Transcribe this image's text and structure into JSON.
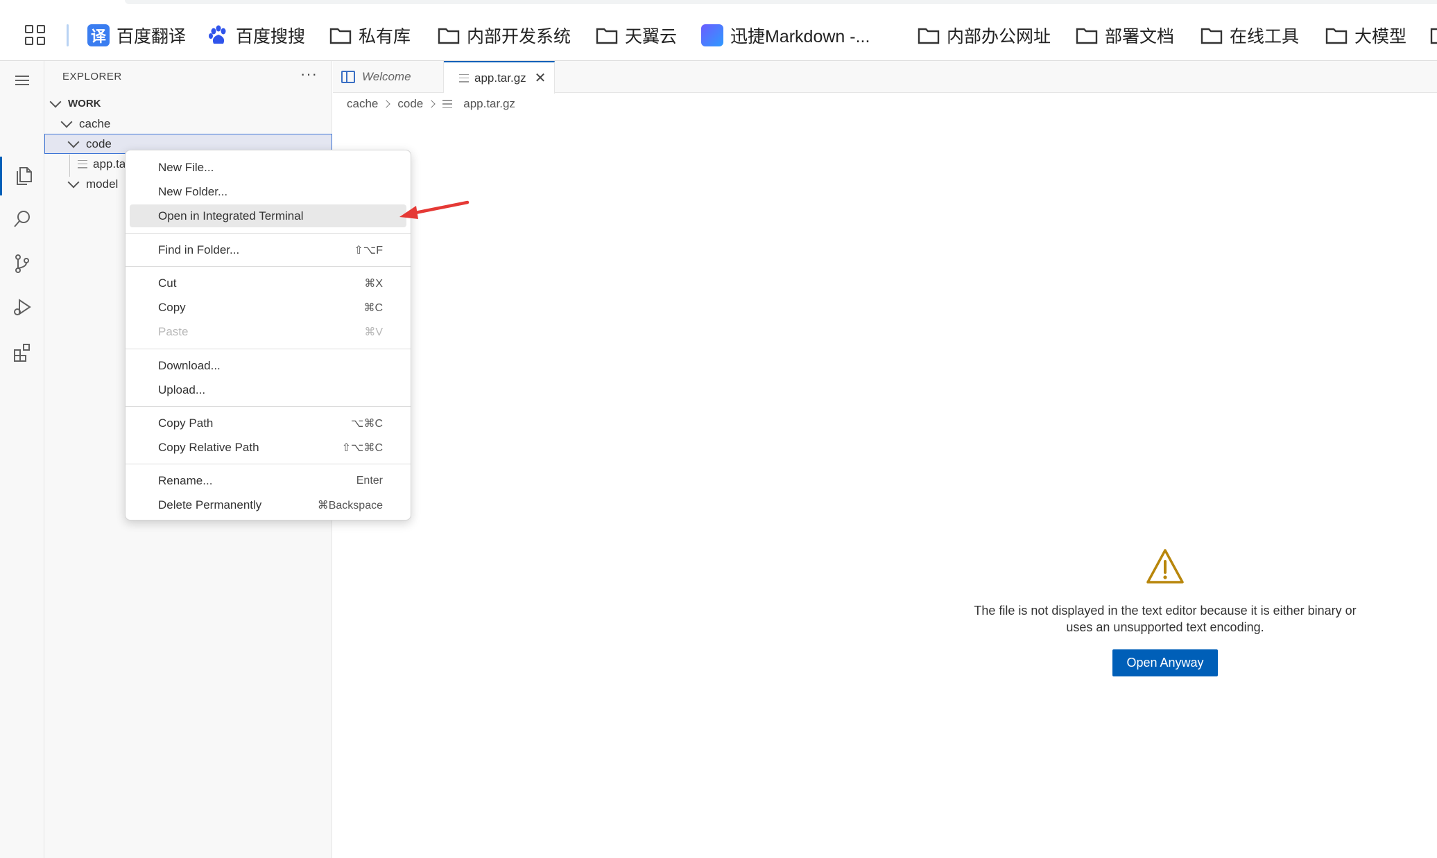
{
  "bookmarks": [
    {
      "label": "百度翻译",
      "icon": "fanyi-icon"
    },
    {
      "label": "百度搜搜",
      "icon": "baidu-paw-icon"
    },
    {
      "label": "私有库",
      "icon": "folder-icon"
    },
    {
      "label": "内部开发系统",
      "icon": "folder-icon"
    },
    {
      "label": "天翼云",
      "icon": "folder-icon"
    },
    {
      "label": "迅捷Markdown -...",
      "icon": "xunjie-icon"
    },
    {
      "label": "内部办公网址",
      "icon": "folder-icon"
    },
    {
      "label": "部署文档",
      "icon": "folder-icon"
    },
    {
      "label": "在线工具",
      "icon": "folder-icon"
    },
    {
      "label": "大模型",
      "icon": "folder-icon"
    }
  ],
  "sidebar": {
    "title": "EXPLORER",
    "more": "···",
    "tree": [
      {
        "label": "WORK",
        "type": "folder"
      },
      {
        "label": "cache",
        "type": "folder"
      },
      {
        "label": "code",
        "type": "folder",
        "selected": true
      },
      {
        "label": "app.ta",
        "type": "file"
      },
      {
        "label": "model",
        "type": "folder"
      }
    ]
  },
  "tabs": [
    {
      "label": "Welcome",
      "active": false
    },
    {
      "label": "app.tar.gz",
      "active": true,
      "close": "✕"
    }
  ],
  "breadcrumb": [
    "cache",
    "code",
    "app.tar.gz"
  ],
  "editor": {
    "message_line1": "The file is not displayed in the text editor because it is either binary or",
    "message_line2": "uses an unsupported text encoding.",
    "open_button": "Open Anyway",
    "warning_color": "#b8860b",
    "accent": "#005fb8"
  },
  "context_menu": {
    "items": [
      {
        "label": "New File...",
        "shortcut": ""
      },
      {
        "label": "New Folder...",
        "shortcut": ""
      },
      {
        "label": "Open in Integrated Terminal",
        "shortcut": "",
        "hover": true
      },
      {
        "label": "Find in Folder...",
        "shortcut": "⇧⌥F"
      },
      {
        "label": "Cut",
        "shortcut": "⌘X"
      },
      {
        "label": "Copy",
        "shortcut": "⌘C"
      },
      {
        "label": "Paste",
        "shortcut": "⌘V",
        "disabled": true
      },
      {
        "label": "Download...",
        "shortcut": ""
      },
      {
        "label": "Upload...",
        "shortcut": ""
      },
      {
        "label": "Copy Path",
        "shortcut": "⌥⌘C"
      },
      {
        "label": "Copy Relative Path",
        "shortcut": "⇧⌥⌘C"
      },
      {
        "label": "Rename...",
        "shortcut": "Enter"
      },
      {
        "label": "Delete Permanently",
        "shortcut": "⌘Backspace"
      }
    ]
  },
  "annotation_color": "#e53935"
}
